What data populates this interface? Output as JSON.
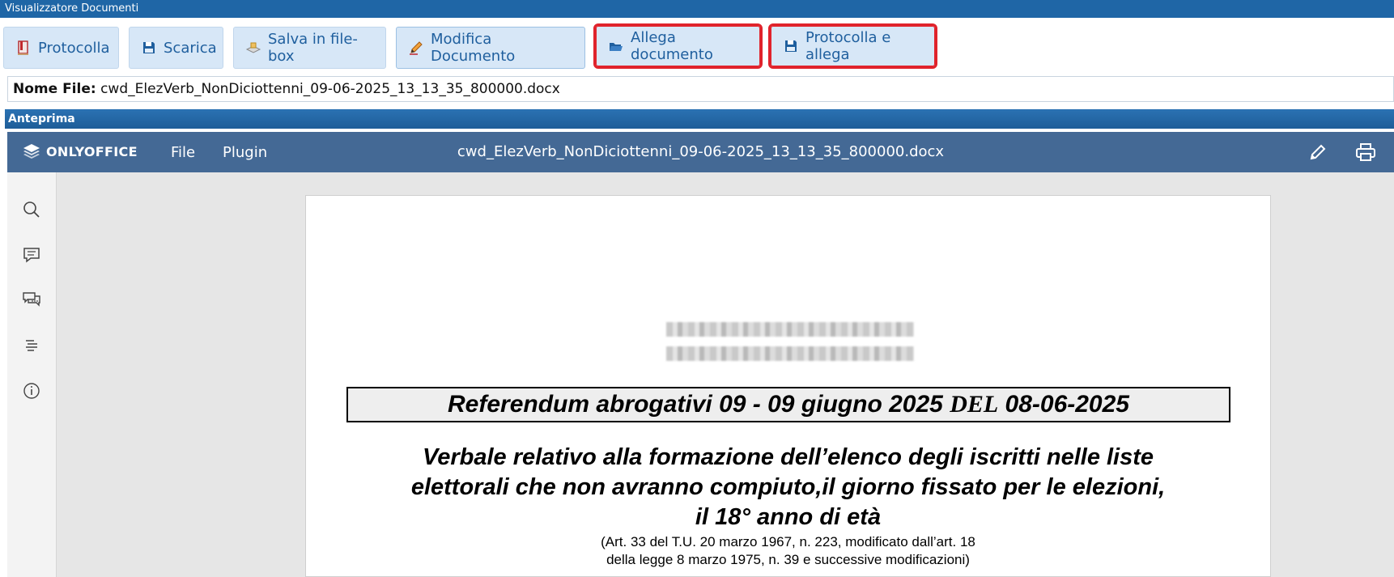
{
  "window": {
    "title": "Visualizzatore Documenti"
  },
  "toolbar": {
    "buttons": [
      {
        "label": "Protocolla",
        "icon": "protocol-book-icon"
      },
      {
        "label": "Scarica",
        "icon": "floppy-save-icon"
      },
      {
        "label": "Salva in file-box",
        "icon": "file-box-icon"
      },
      {
        "label": "Modifica Documento",
        "icon": "pencil-icon"
      },
      {
        "label": "Allega documento",
        "icon": "folder-open-icon"
      },
      {
        "label": "Protocolla e allega",
        "icon": "floppy-save-icon"
      }
    ]
  },
  "file": {
    "label": "Nome File:",
    "name": "cwd_ElezVerb_NonDiciottenni_09-06-2025_13_13_35_800000.docx"
  },
  "preview": {
    "title": "Anteprima"
  },
  "onlyoffice": {
    "brand": "ONLYOFFICE",
    "menu": [
      "File",
      "Plugin"
    ],
    "doc_title": "cwd_ElezVerb_NonDiciottenni_09-06-2025_13_13_35_800000.docx",
    "left_icons": [
      "search-icon",
      "comment-icon",
      "chat-icon",
      "navigation-icon",
      "info-icon"
    ],
    "header_icons": [
      "edit-pencil-icon",
      "print-icon"
    ]
  },
  "document": {
    "referendum_part1": "Referendum abrogativi 09 - 09 giugno 2025 ",
    "referendum_del": "DEL",
    "referendum_part2": " 08-06-2025",
    "verbale_lines": [
      "Verbale relativo alla formazione dell’elenco degli iscritti nelle liste",
      "elettorali che non avranno compiuto,il giorno fissato per le elezioni,",
      "il 18° anno di età"
    ],
    "art_lines": [
      "(Art. 33 del T.U. 20 marzo 1967, n. 223, modificato dall’art. 18",
      "della legge 8 marzo 1975, n. 39 e successive modificazioni)"
    ]
  },
  "colors": {
    "titlebar": "#1f66a6",
    "onlyoffice_header": "#446995",
    "highlight": "#e0232c",
    "button_bg": "#d7e7f7"
  }
}
